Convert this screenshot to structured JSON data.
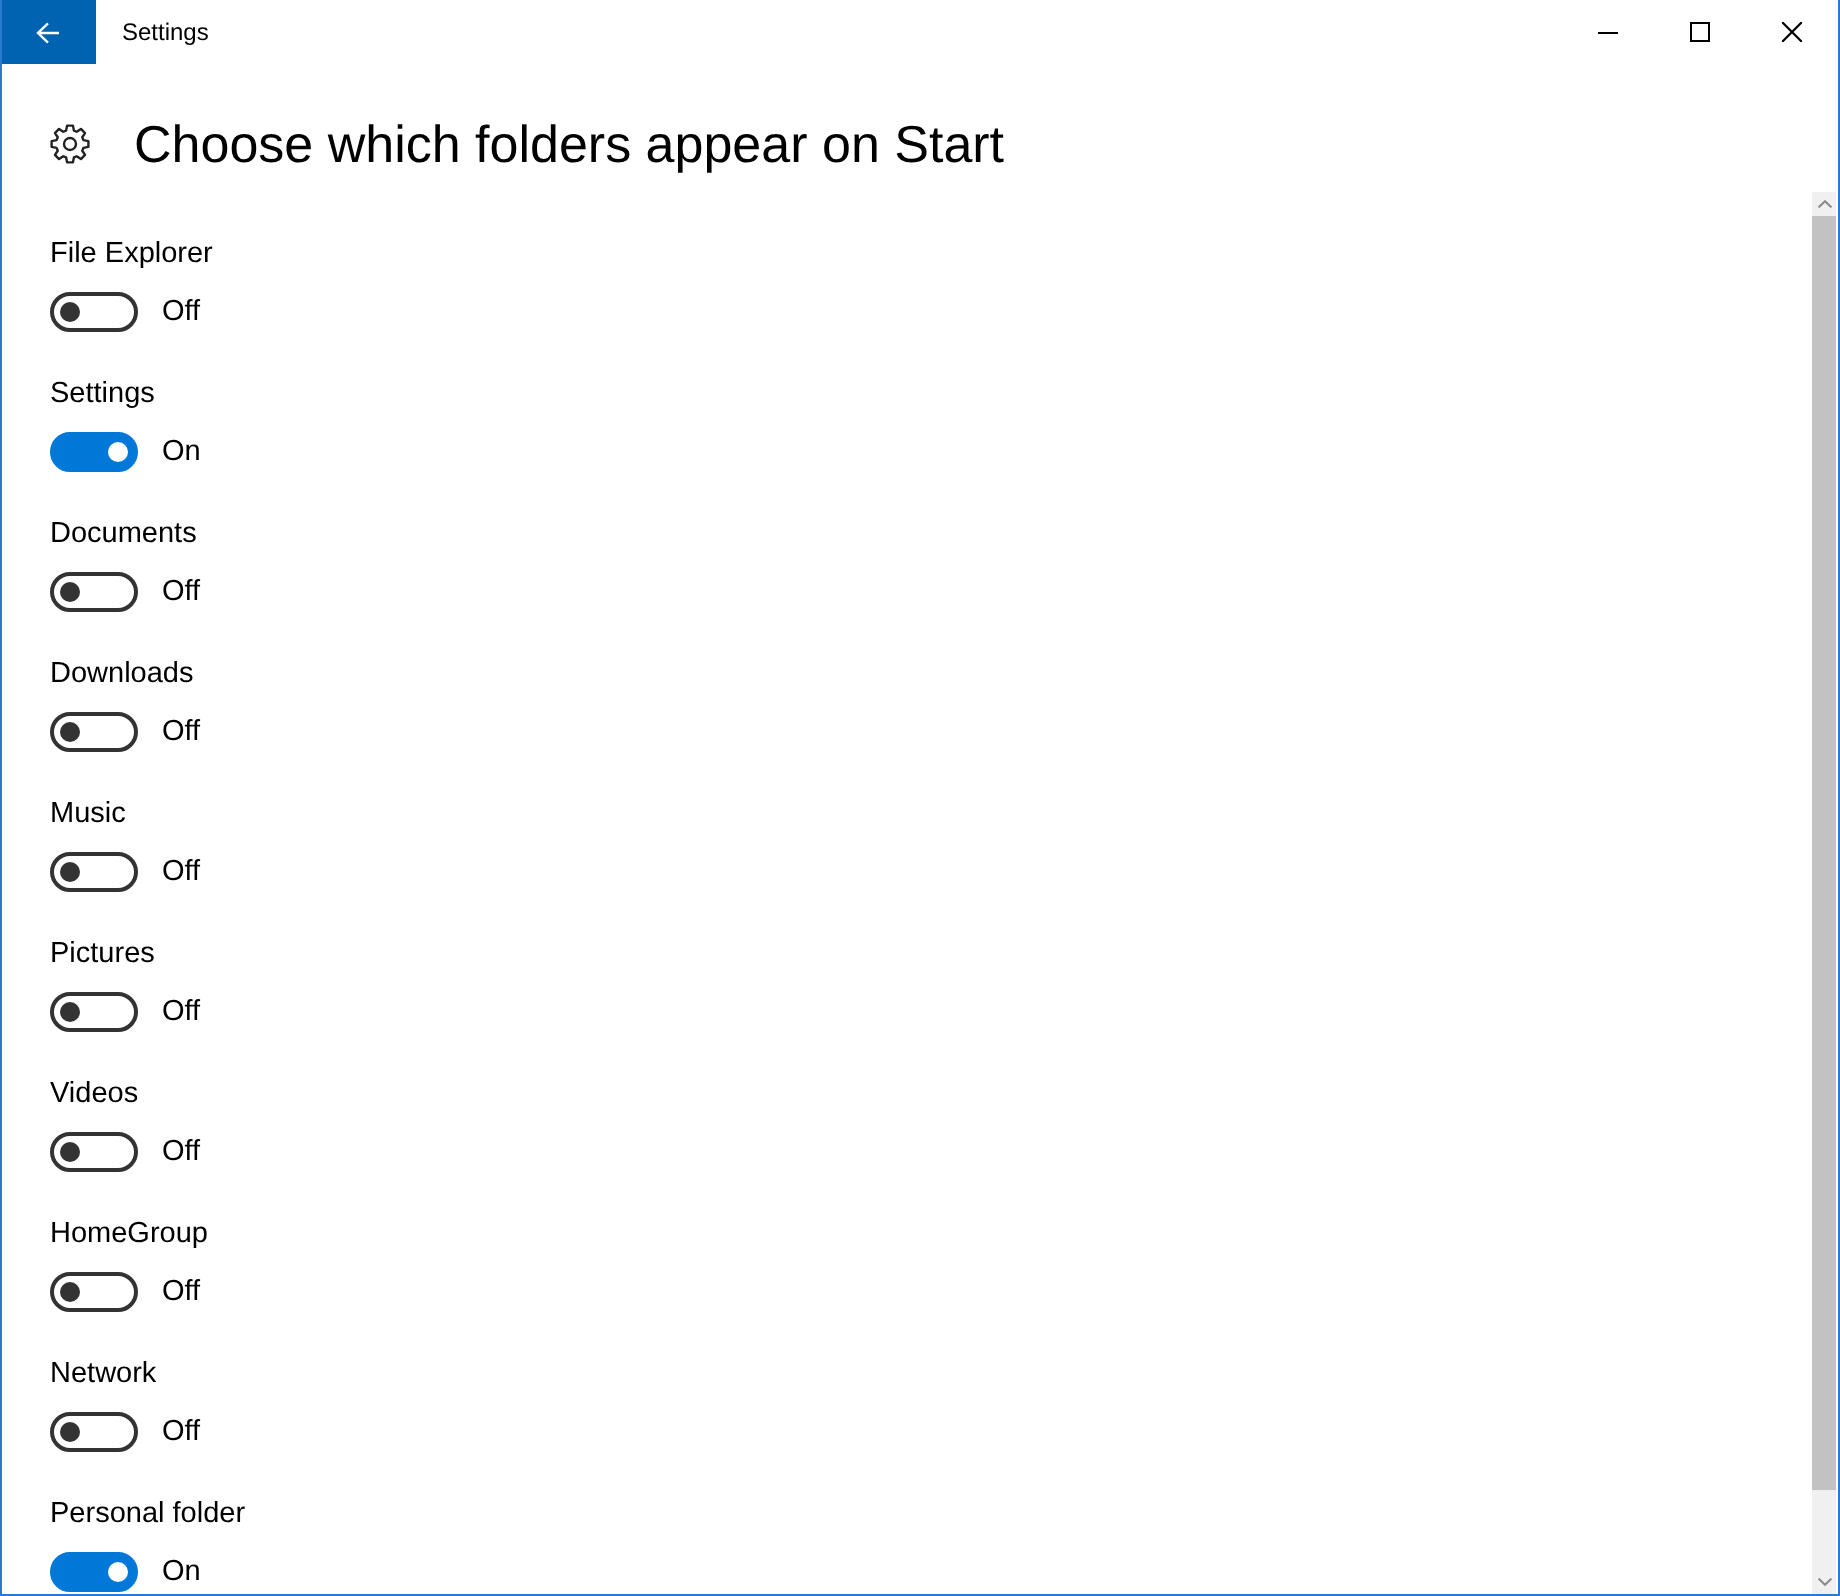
{
  "window": {
    "title": "Settings"
  },
  "page": {
    "heading": "Choose which folders appear on Start"
  },
  "folders": [
    {
      "label": "File Explorer",
      "on": false,
      "state_text": "Off"
    },
    {
      "label": "Settings",
      "on": true,
      "state_text": "On"
    },
    {
      "label": "Documents",
      "on": false,
      "state_text": "Off"
    },
    {
      "label": "Downloads",
      "on": false,
      "state_text": "Off"
    },
    {
      "label": "Music",
      "on": false,
      "state_text": "Off"
    },
    {
      "label": "Pictures",
      "on": false,
      "state_text": "Off"
    },
    {
      "label": "Videos",
      "on": false,
      "state_text": "Off"
    },
    {
      "label": "HomeGroup",
      "on": false,
      "state_text": "Off"
    },
    {
      "label": "Network",
      "on": false,
      "state_text": "Off"
    },
    {
      "label": "Personal folder",
      "on": true,
      "state_text": "On"
    }
  ]
}
